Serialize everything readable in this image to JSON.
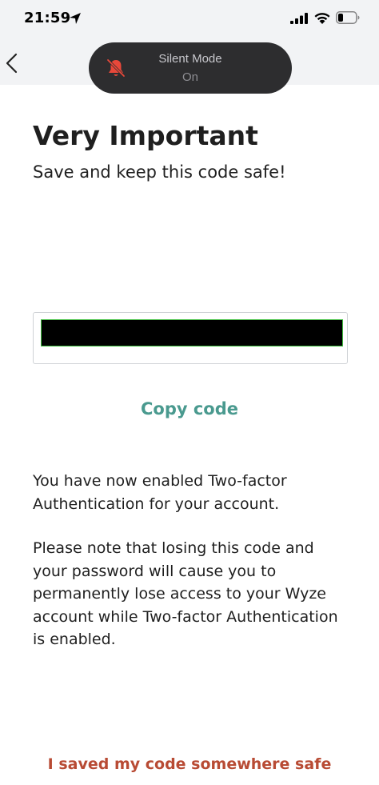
{
  "status_bar": {
    "time": "21:59"
  },
  "notification": {
    "title": "Silent Mode",
    "state": "On"
  },
  "header": {
    "title": "Very Important",
    "subtitle": "Save and keep this code safe!"
  },
  "actions": {
    "copy_label": "Copy code",
    "confirm_label": "I saved my code somewhere safe"
  },
  "body": {
    "paragraph_1": "You have now enabled Two-factor Authentication for your account.",
    "paragraph_2": "Please note that losing this code and your password will cause you to permanently lose access to your Wyze account while Two-factor Authentication is enabled."
  },
  "icons": {
    "back": "chevron-left-icon",
    "location": "location-arrow-icon",
    "signal": "cellular-signal-icon",
    "wifi": "wifi-icon",
    "battery": "battery-icon",
    "bell": "bell-slash-icon"
  },
  "colors": {
    "accent_teal": "#4a9a8f",
    "accent_red": "#b84b34",
    "silent_icon": "#e8483a"
  }
}
